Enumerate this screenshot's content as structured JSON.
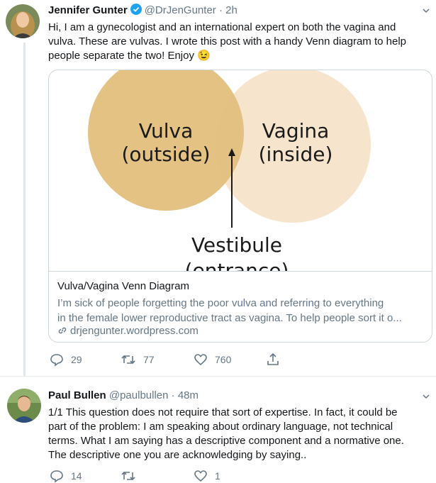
{
  "tweet1": {
    "name": "Jennifer Gunter",
    "handle": "@DrJenGunter",
    "time": "· 2h",
    "text_lines": [
      "Hi, I am a gynecologist and an international expert on both the vagina and",
      "vulva. These are vulvas. I wrote this post with a handy Venn diagram to help",
      "people separate the two! Enjoy 😉"
    ],
    "card": {
      "image_labels": {
        "vulva_line1": "Vulva",
        "vulva_line2": "(outside)",
        "vagina_line1": "Vagina",
        "vagina_line2": "(inside)",
        "vestibule": "Vestibule",
        "entrance": "(entrance)"
      },
      "title": "Vulva/Vagina Venn Diagram",
      "desc_lines": [
        "I’m sick of people forgetting the poor vulva and referring to everything",
        "in the female lower reproductive tract as vagina. To help people sort it o..."
      ],
      "link": "drjengunter.wordpress.com"
    },
    "actions": {
      "replies": "29",
      "retweets": "77",
      "likes": "760"
    }
  },
  "tweet2": {
    "name": "Paul Bullen",
    "handle": "@paulbullen",
    "time": "· 48m",
    "text_lines": [
      "1/1 This question does not require that sort of expertise. In fact, it could be",
      "part of the problem: I am speaking about ordinary language, not technical",
      "terms. What I am saying has a descriptive component and a normative one.",
      "The descriptive one you are acknowledging by saying.."
    ],
    "actions": {
      "replies": "14",
      "retweets": "",
      "likes": "1"
    }
  },
  "colors": {
    "accent": "#1da1f2",
    "muted": "#657786",
    "vulva_circle": "#e2bf7d",
    "vagina_circle": "#f6e5cc"
  }
}
